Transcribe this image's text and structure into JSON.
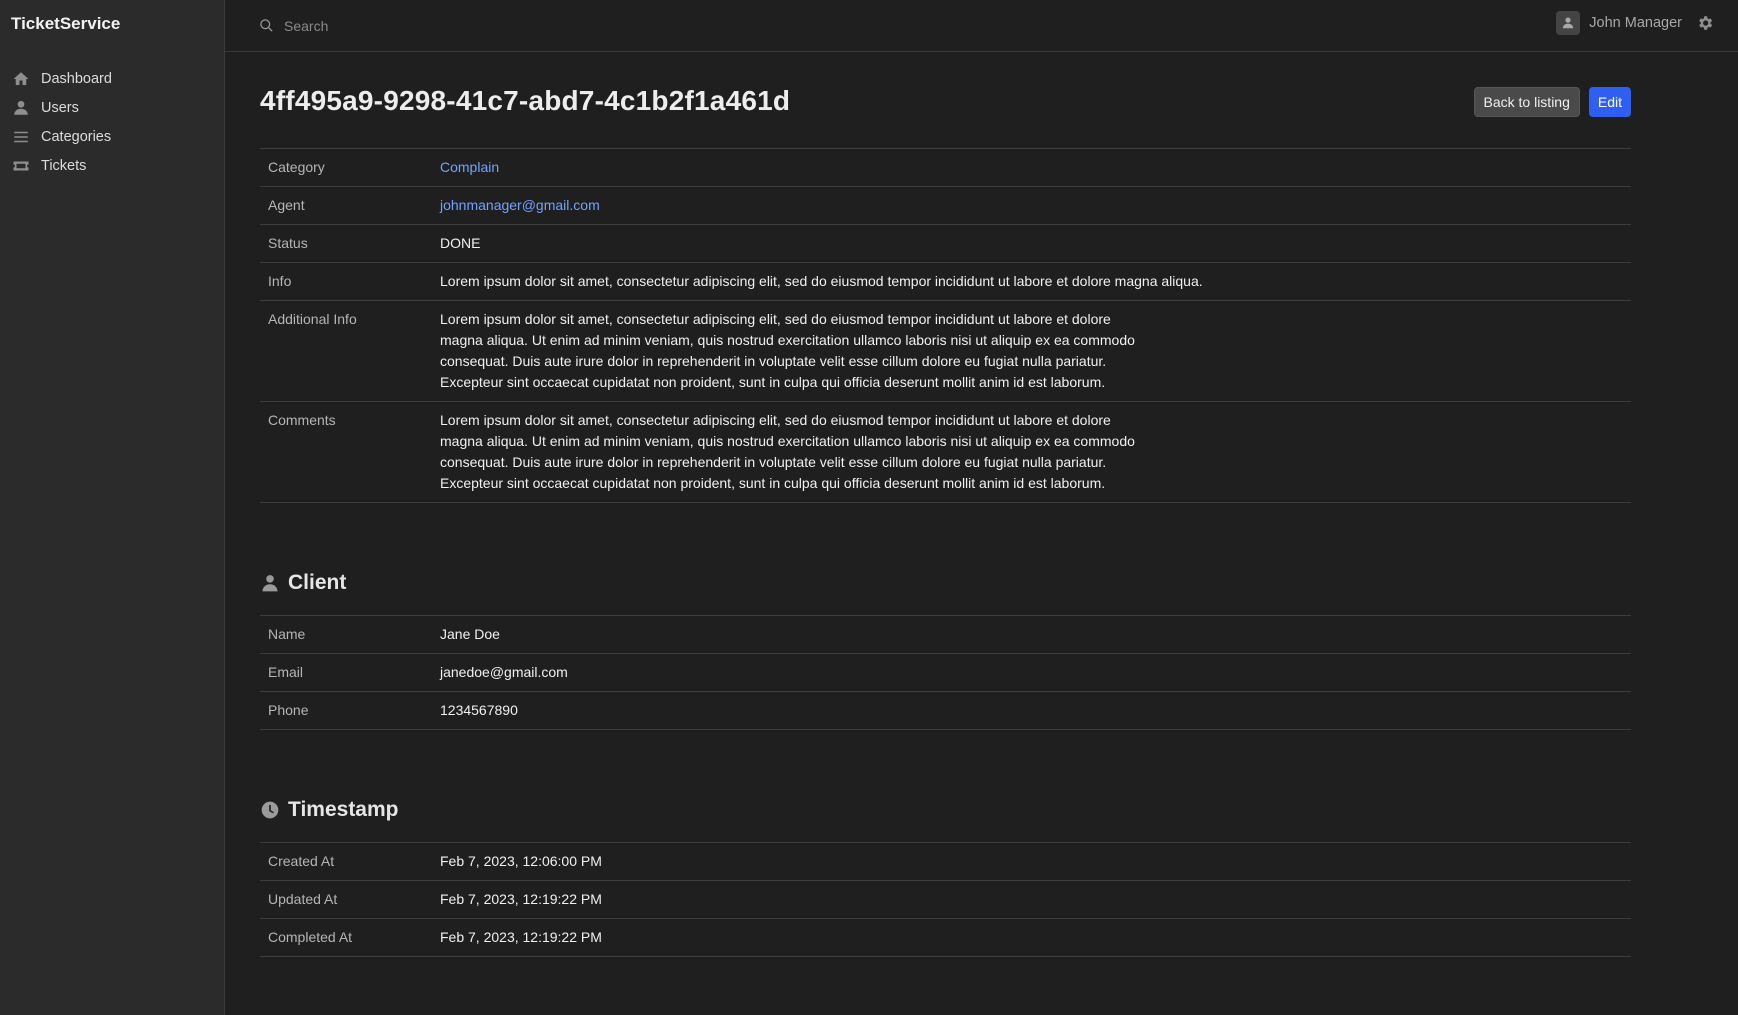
{
  "app": {
    "brand": "TicketService"
  },
  "sidebar": {
    "items": [
      {
        "label": "Dashboard",
        "icon": "home-icon"
      },
      {
        "label": "Users",
        "icon": "user-icon"
      },
      {
        "label": "Categories",
        "icon": "list-icon"
      },
      {
        "label": "Tickets",
        "icon": "ticket-icon"
      }
    ]
  },
  "topbar": {
    "search_placeholder": "Search",
    "user_name": "John Manager"
  },
  "page": {
    "title": "4ff495a9-9298-41c7-abd7-4c1b2f1a461d",
    "back_label": "Back to listing",
    "edit_label": "Edit"
  },
  "ticket": {
    "rows": [
      {
        "label": "Category",
        "value": "Complain"
      },
      {
        "label": "Agent",
        "value": "johnmanager@gmail.com"
      },
      {
        "label": "Status",
        "value": "DONE"
      },
      {
        "label": "Info",
        "value": "Lorem ipsum dolor sit amet, consectetur adipiscing elit, sed do eiusmod tempor incididunt ut labore et dolore magna aliqua."
      },
      {
        "label": "Additional Info",
        "value": "Lorem ipsum dolor sit amet, consectetur adipiscing elit, sed do eiusmod tempor incididunt ut labore et dolore magna aliqua. Ut enim ad minim veniam, quis nostrud exercitation ullamco laboris nisi ut aliquip ex ea commodo consequat. Duis aute irure dolor in reprehenderit in voluptate velit esse cillum dolore eu fugiat nulla pariatur. Excepteur sint occaecat cupidatat non proident, sunt in culpa qui officia deserunt mollit anim id est laborum."
      },
      {
        "label": "Comments",
        "value": "Lorem ipsum dolor sit amet, consectetur adipiscing elit, sed do eiusmod tempor incididunt ut labore et dolore magna aliqua. Ut enim ad minim veniam, quis nostrud exercitation ullamco laboris nisi ut aliquip ex ea commodo consequat. Duis aute irure dolor in reprehenderit in voluptate velit esse cillum dolore eu fugiat nulla pariatur. Excepteur sint occaecat cupidatat non proident, sunt in culpa qui officia deserunt mollit anim id est laborum."
      }
    ]
  },
  "client": {
    "title": "Client",
    "rows": [
      {
        "label": "Name",
        "value": "Jane Doe"
      },
      {
        "label": "Email",
        "value": "janedoe@gmail.com"
      },
      {
        "label": "Phone",
        "value": "1234567890"
      }
    ]
  },
  "timestamp": {
    "title": "Timestamp",
    "rows": [
      {
        "label": "Created At",
        "value": "Feb 7, 2023, 12:06:00 PM"
      },
      {
        "label": "Updated At",
        "value": "Feb 7, 2023, 12:19:22 PM"
      },
      {
        "label": "Completed At",
        "value": "Feb 7, 2023, 12:19:22 PM"
      }
    ]
  },
  "colors": {
    "background": "#1f1f1f",
    "sidebar": "#2b2b2b",
    "primary": "#2f5ff0",
    "link": "#6fa3ff"
  }
}
